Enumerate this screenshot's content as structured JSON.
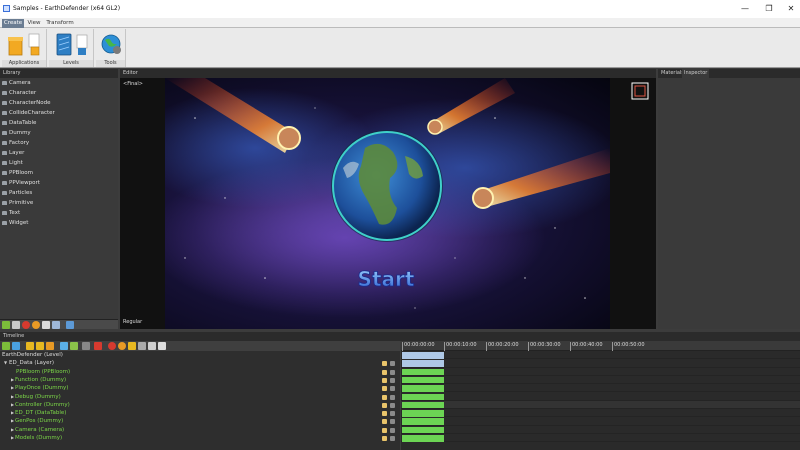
{
  "window": {
    "title": "Samples - EarthDefender (x64 GL2)",
    "minimize": "—",
    "maximize": "❐",
    "close": "✕"
  },
  "ribbon": {
    "tabs": [
      "Create",
      "View",
      "Transform"
    ],
    "groups": [
      {
        "label": "Applications",
        "icon": "application-icon"
      },
      {
        "label": "Levels",
        "icon": "levels-icon"
      },
      {
        "label": "Tools",
        "icon": "tools-icon"
      }
    ]
  },
  "library": {
    "header": "Library",
    "items": [
      "Camera",
      "Character",
      "CharacterNode",
      "CollideCharacter",
      "DataTable",
      "Dummy",
      "Factory",
      "Layer",
      "Light",
      "PPBloom",
      "PPViewport",
      "Particles",
      "Primitive",
      "Text",
      "Widget"
    ]
  },
  "editor": {
    "header": "Editor",
    "view_label": "<Final>",
    "mode_label": "Regular",
    "start_text": "Start"
  },
  "right_panel": {
    "tabs": [
      "Materials",
      "Inspector"
    ]
  },
  "timeline": {
    "header": "Timeline",
    "root": "EarthDefender (Level)",
    "tracks": [
      {
        "label": "ED_Data (Layer)",
        "indent": 1,
        "arrow": "▼",
        "clip": "blue"
      },
      {
        "label": "PPBloom (PPBloom)",
        "indent": 3,
        "arrow": "",
        "clip": "green"
      },
      {
        "label": "Function (Dummy)",
        "indent": 2,
        "arrow": "▶",
        "clip": "green"
      },
      {
        "label": "PlayOnce (Dummy)",
        "indent": 2,
        "arrow": "▶",
        "clip": "green"
      },
      {
        "label": "Debug (Dummy)",
        "indent": 2,
        "arrow": "▶",
        "clip": "green"
      },
      {
        "label": "Controller (Dummy)",
        "indent": 2,
        "arrow": "▶",
        "clip": "green"
      },
      {
        "label": "ED_DT (DataTable)",
        "indent": 2,
        "arrow": "▶",
        "clip": "green"
      },
      {
        "label": "GenPos (Dummy)",
        "indent": 2,
        "arrow": "▶",
        "clip": "green"
      },
      {
        "label": "Camera (Camera)",
        "indent": 2,
        "arrow": "▶",
        "clip": "green"
      },
      {
        "label": "Models (Dummy)",
        "indent": 2,
        "arrow": "▶",
        "clip": "green"
      }
    ],
    "ruler": [
      "00:00:00:00",
      "00:00:10:00",
      "00:00:20:00",
      "00:00:30:00",
      "00:00:40:00",
      "00:00:50:00"
    ]
  }
}
